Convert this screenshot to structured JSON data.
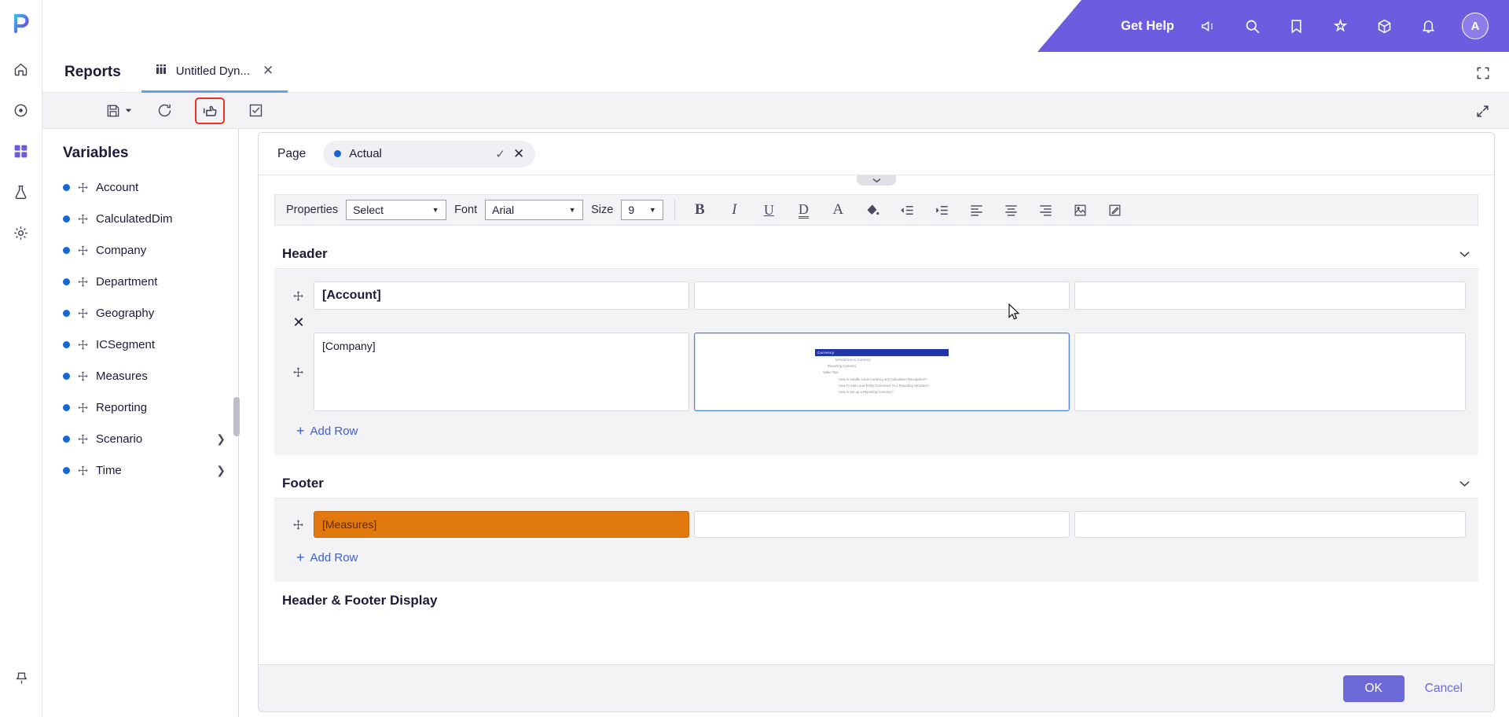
{
  "app": {
    "logo": "p-logo",
    "rail_items": [
      {
        "name": "home-icon",
        "label": "Home"
      },
      {
        "name": "target-icon",
        "label": "Dashboards"
      },
      {
        "name": "grid-icon",
        "label": "Apps"
      },
      {
        "name": "flask-icon",
        "label": "Modeling"
      },
      {
        "name": "gear-icon",
        "label": "Settings"
      }
    ],
    "rail_bottom": {
      "name": "pin-icon",
      "label": "Pin"
    }
  },
  "header": {
    "get_help": "Get Help",
    "icons": [
      {
        "name": "megaphone-icon"
      },
      {
        "name": "search-icon"
      },
      {
        "name": "bookmark-icon"
      },
      {
        "name": "sparkle-icon"
      },
      {
        "name": "cube-icon"
      },
      {
        "name": "bell-icon"
      }
    ],
    "avatar_initial": "A",
    "accent_color": "#6c5ce0"
  },
  "tabstrip": {
    "section_title": "Reports",
    "tab_label": "Untitled Dyn...",
    "tab_icon": "report-grid-icon",
    "close_label": "✕",
    "expand_label": "fullscreen-icon"
  },
  "actionbar": {
    "buttons": [
      {
        "name": "save-button",
        "label": "save-icon"
      },
      {
        "name": "refresh-button",
        "label": "refresh-icon"
      },
      {
        "name": "publish-button",
        "label": "publish-hand-icon"
      },
      {
        "name": "checklist-button",
        "label": "checklist-icon"
      }
    ],
    "highlight_color": "#ee3124",
    "expand_button": "expand-diagonal-icon"
  },
  "variables": {
    "title": "Variables",
    "items": [
      {
        "label": "Account",
        "expandable": false
      },
      {
        "label": "CalculatedDim",
        "expandable": false
      },
      {
        "label": "Company",
        "expandable": false
      },
      {
        "label": "Department",
        "expandable": false
      },
      {
        "label": "Geography",
        "expandable": false
      },
      {
        "label": "ICSegment",
        "expandable": false
      },
      {
        "label": "Measures",
        "expandable": false
      },
      {
        "label": "Reporting",
        "expandable": false
      },
      {
        "label": "Scenario",
        "expandable": true
      },
      {
        "label": "Time",
        "expandable": true
      }
    ],
    "dot_color": "#1667d6"
  },
  "dialog": {
    "page_label": "Page",
    "page_chip": {
      "value": "Actual",
      "confirm": "✓",
      "clear": "✕"
    },
    "format_toolbar": {
      "properties_label": "Properties",
      "properties_value": "Select",
      "font_label": "Font",
      "font_value": "Arial",
      "size_label": "Size",
      "size_value": "9",
      "buttons": [
        {
          "name": "bold-button",
          "glyph": "B"
        },
        {
          "name": "italic-button",
          "glyph": "I"
        },
        {
          "name": "underline-button",
          "glyph": "U"
        },
        {
          "name": "double-underline-button",
          "glyph": "D"
        },
        {
          "name": "font-color-button",
          "glyph": "A"
        },
        {
          "name": "fill-color-button",
          "glyph": "fill"
        },
        {
          "name": "decrease-indent-button",
          "glyph": "outdent"
        },
        {
          "name": "increase-indent-button",
          "glyph": "indent"
        },
        {
          "name": "align-left-button",
          "glyph": "align-left"
        },
        {
          "name": "align-center-button",
          "glyph": "align-center"
        },
        {
          "name": "align-right-button",
          "glyph": "align-right"
        },
        {
          "name": "insert-image-button",
          "glyph": "image"
        },
        {
          "name": "edit-note-button",
          "glyph": "note"
        }
      ]
    },
    "sections": [
      {
        "title": "Header",
        "rows": [
          {
            "cells": [
              "[Account]",
              "",
              ""
            ],
            "bold_first": true,
            "selected_index": -1,
            "has_close": true
          },
          {
            "cells": [
              "[Company]",
              "__THUMBNAIL__",
              ""
            ],
            "bold_first": false,
            "selected_index": 1,
            "has_close": false
          }
        ],
        "add_row_label": "Add Row"
      },
      {
        "title": "Footer",
        "rows": [
          {
            "cells": [
              "[Measures]",
              "",
              ""
            ],
            "bold_first": false,
            "selected_index": -1,
            "orange_first": true,
            "has_close": false
          }
        ],
        "add_row_label": "Add Row"
      }
    ],
    "next_section_title": "Header & Footer Display",
    "thumbnail": {
      "title": "Currency",
      "lines": [
        "Introduction to Currency",
        "Reporting Currency",
        "Video Tips",
        "How to Handle Local Currency and Calculation Recognition?",
        "How To Add Local Entity Currencies To a Reporting Structure?",
        "How to Set up a Reporting Currency?"
      ],
      "title_bar_color": "#2036a8"
    },
    "footer_buttons": {
      "ok": "OK",
      "cancel": "Cancel",
      "ok_color": "#6c68d8"
    }
  }
}
